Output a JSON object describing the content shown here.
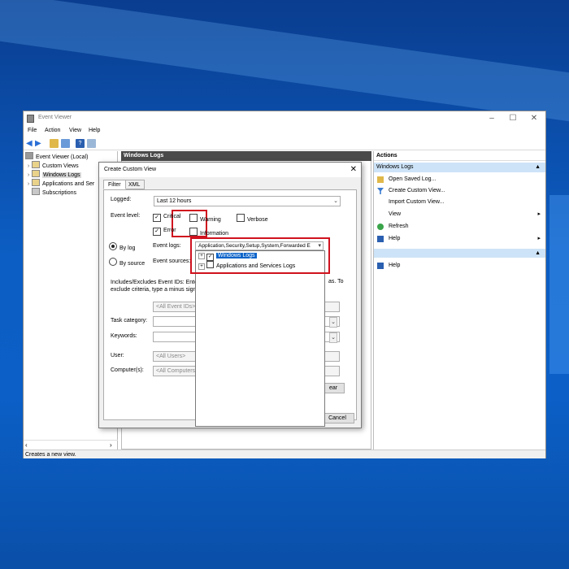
{
  "window": {
    "title": "Event Viewer",
    "menu": [
      "File",
      "Action",
      "View",
      "Help"
    ]
  },
  "tree": {
    "items": [
      {
        "label": "Event Viewer (Local)"
      },
      {
        "label": "Custom Views"
      },
      {
        "label": "Windows Logs"
      },
      {
        "label": "Applications and Ser"
      },
      {
        "label": "Subscriptions"
      }
    ]
  },
  "middle": {
    "header": "Windows Logs"
  },
  "actions": {
    "header": "Actions",
    "section1": "Windows Logs",
    "items": [
      "Open Saved Log...",
      "Create Custom View...",
      "Import Custom View...",
      "View",
      "Refresh",
      "Help"
    ],
    "section2_item": "Help"
  },
  "status": {
    "text": "Creates a new view."
  },
  "dialog": {
    "title": "Create Custom View",
    "tabs": [
      "Filter",
      "XML"
    ],
    "logged_label": "Logged:",
    "logged_value": "Last 12 hours",
    "event_level_label": "Event level:",
    "levels": {
      "critical": "Critical",
      "warning": "Warning",
      "verbose": "Verbose",
      "error": "Error",
      "information": "Information"
    },
    "by_log": "By log",
    "by_source": "By source",
    "event_logs_label": "Event logs:",
    "event_sources_label": "Event sources:",
    "event_logs_value": "Application,Security,Setup,System,Forwarded E",
    "desc_line1": "Includes/Excludes Event IDs: Ente",
    "desc_line1_end": "as. To",
    "desc_line2": "exclude criteria, type a minus sign",
    "all_event_ids": "<All Event IDs>",
    "task_category_label": "Task category:",
    "keywords_label": "Keywords:",
    "user_label": "User:",
    "user_value": "<All Users>",
    "computer_label": "Computer(s):",
    "computer_value": "<All Computers",
    "clear_btn": "ear",
    "cancel_btn": "Cancel"
  },
  "dropdown": {
    "items": [
      "Windows Logs",
      "Applications and Services Logs"
    ]
  },
  "colors": {
    "highlight": "#d0121f",
    "selection": "#0a63c9",
    "desktop": "#0c5ec4"
  }
}
